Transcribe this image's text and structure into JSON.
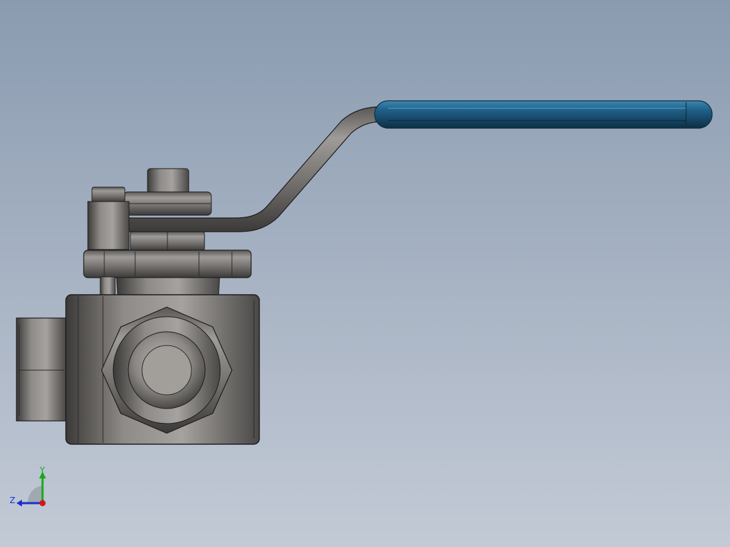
{
  "viewport": {
    "background_top": "#8a9bb0",
    "background_bottom": "#c3cad6"
  },
  "model": {
    "body_color": "#8c8a88",
    "body_dark": "#3a3836",
    "handle_color": "#1f5f86",
    "handle_dark": "#0d2f45",
    "edge_color": "#1c1c1c"
  },
  "triad": {
    "y_label": "Y",
    "z_label": "Z",
    "y_color": "#18a818",
    "z_color": "#1c2ed0",
    "x_color": "#d01818"
  }
}
